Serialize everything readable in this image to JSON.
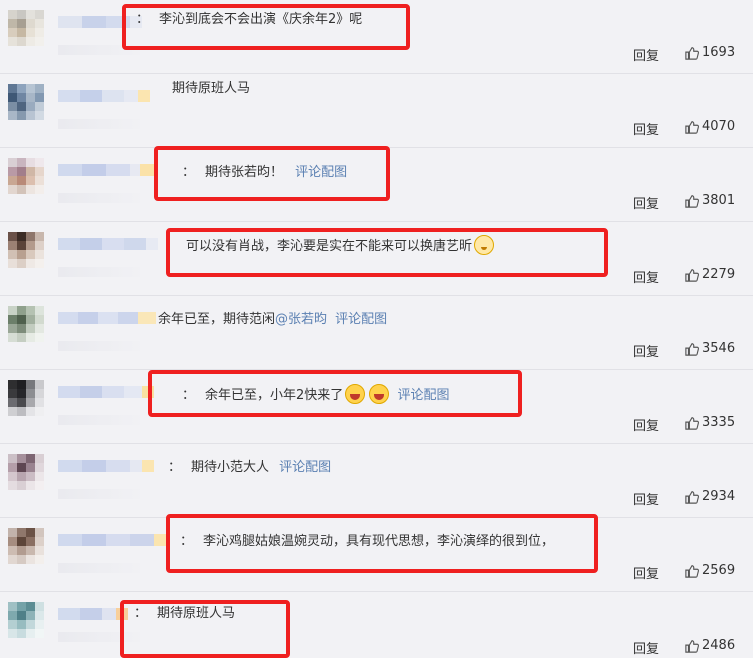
{
  "reply_label": "回复",
  "comments": [
    {
      "text": "李沁到底会不会出演《庆余年2》呢",
      "likes": "1693",
      "sep": "：",
      "link": ""
    },
    {
      "text": "期待原班人马",
      "likes": "4070",
      "sep": "",
      "link": ""
    },
    {
      "text": "期待张若昀！",
      "likes": "3801",
      "sep": "：",
      "link": "评论配图"
    },
    {
      "text": "可以没有肖战，李沁要是实在不能来可以换唐艺昕",
      "likes": "2279",
      "sep": "",
      "link": ""
    },
    {
      "text": "余年已至，期待范闲",
      "mention": "@张若昀",
      "likes": "3546",
      "sep": "",
      "link": "评论配图"
    },
    {
      "text": "余年已至，小年2快来了",
      "likes": "3335",
      "sep": "：",
      "link": "评论配图"
    },
    {
      "text": "期待小范大人",
      "likes": "2934",
      "sep": "：",
      "link": "评论配图"
    },
    {
      "text": "李沁鸡腿姑娘温婉灵动，具有现代思想，李沁演绎的很到位，",
      "likes": "2569",
      "sep": "：",
      "link": ""
    },
    {
      "text": "期待原班人马",
      "likes": "2486",
      "sep": "：",
      "link": ""
    }
  ],
  "colors": {
    "accent_link": "#5b80b2",
    "highlight_box": "#ef2020",
    "background": "#f2f2f5"
  },
  "icons": {
    "like": "thumbs-up-icon",
    "emoji": "laughing-face-icon"
  }
}
